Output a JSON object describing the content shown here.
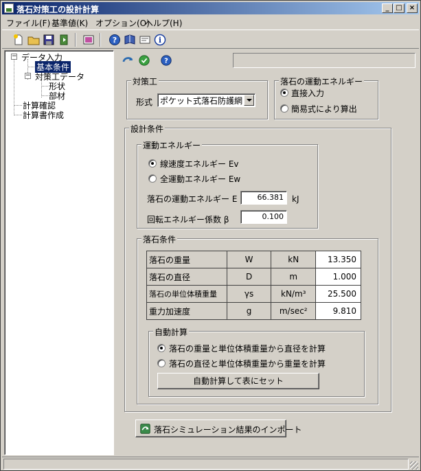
{
  "window": {
    "title": "落石対策工の設計計算",
    "minimize": "_",
    "maximize": "□",
    "close": "×"
  },
  "menu": [
    {
      "label": "ファイル(F)"
    },
    {
      "label": "基準値(K)"
    },
    {
      "label": "オプション(O)"
    },
    {
      "label": "ヘルプ(H)"
    }
  ],
  "toolbar_icons": [
    "new-file-icon",
    "open-folder-icon",
    "save-disk-icon",
    "export-icon",
    "color-settings-icon",
    "help-icon",
    "book-icon",
    "card-icon",
    "info-icon"
  ],
  "tree": {
    "root": "データ入力",
    "basic": "基本条件",
    "countermeasure": "対策工データ",
    "shape": "形状",
    "member": "部材",
    "check": "計算確認",
    "report": "計算書作成"
  },
  "countermeasure": {
    "legend": "対策工",
    "type_label": "形式",
    "type_value": "ポケット式落石防護網"
  },
  "energy_input": {
    "legend": "落石の運動エネルギー",
    "direct": "直接入力",
    "simple": "簡易式により算出",
    "selected": "direct"
  },
  "design": {
    "legend": "設計条件",
    "kinetic": {
      "legend": "運動エネルギー",
      "ev": "線速度エネルギー Ev",
      "ew": "全運動エネルギー Ew",
      "selected": "ev",
      "energy_label": "落石の運動エネルギー E",
      "energy_value": "66.381",
      "energy_unit": "kJ",
      "beta_label": "回転エネルギー係数 β",
      "beta_value": "0.100"
    },
    "rock": {
      "legend": "落石条件",
      "rows": [
        {
          "name": "落石の重量",
          "symbol": "W",
          "unit": "kN",
          "value": "13.350"
        },
        {
          "name": "落石の直径",
          "symbol": "D",
          "unit": "m",
          "value": "1.000"
        },
        {
          "name": "落石の単位体積重量",
          "symbol": "γs",
          "unit": "kN/m³",
          "value": "25.500"
        },
        {
          "name": "重力加速度",
          "symbol": "g",
          "unit": "m/sec²",
          "value": "9.810"
        }
      ],
      "auto": {
        "legend": "自動計算",
        "opt1": "落石の重量と単位体積重量から直径を計算",
        "opt2": "落石の直径と単位体積重量から重量を計算",
        "selected": "opt1",
        "button": "自動計算して表にセット"
      }
    }
  },
  "import_button": "落石シミュレーション結果のインポート"
}
